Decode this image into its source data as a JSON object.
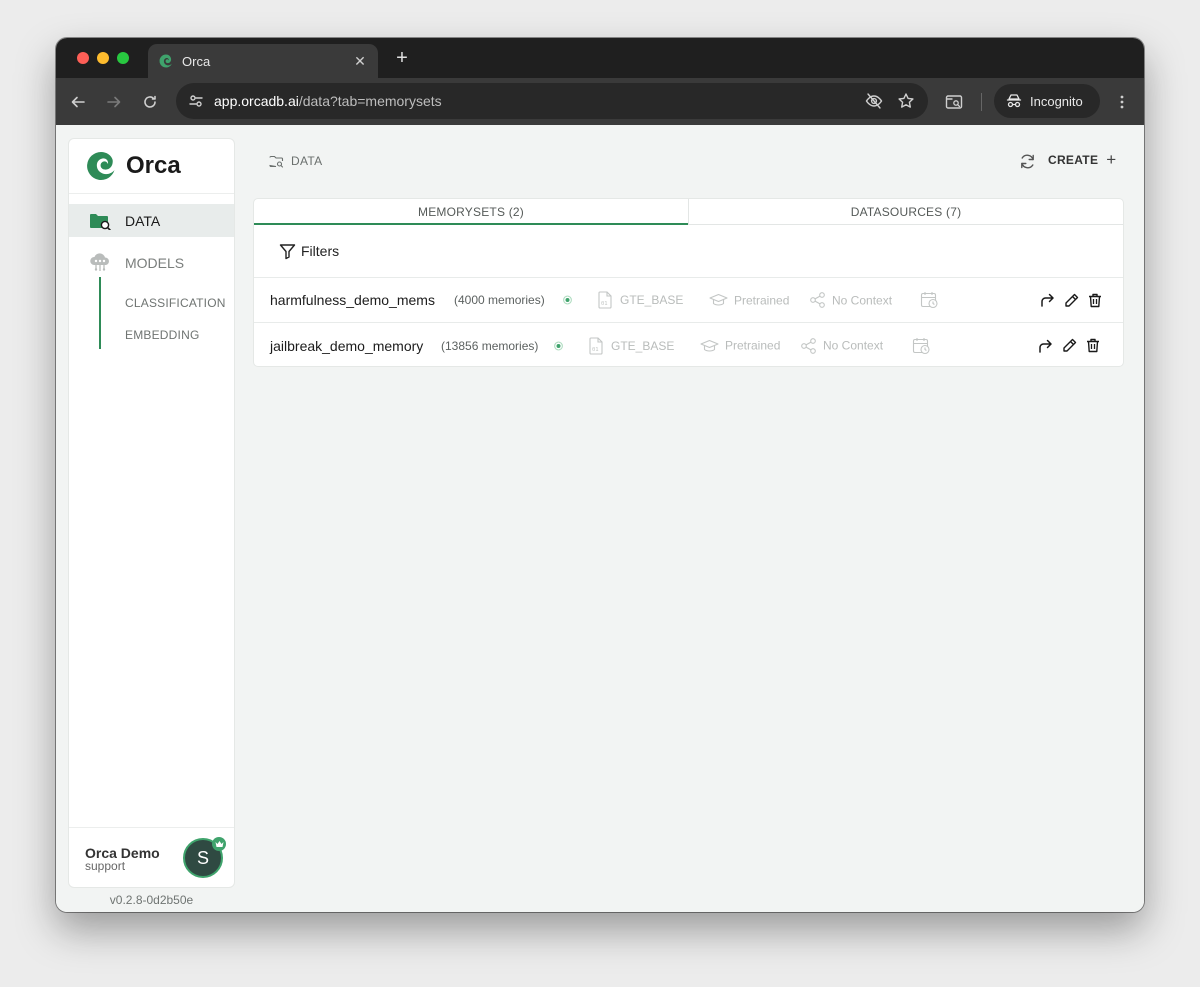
{
  "browser": {
    "tab_title": "Orca",
    "url_host": "app.orcadb.ai",
    "url_path": "/data?tab=memorysets",
    "incognito_label": "Incognito"
  },
  "sidebar": {
    "logo_text": "Orca",
    "nav": {
      "data_label": "DATA",
      "models_label": "MODELS",
      "models_sub": [
        "CLASSIFICATION",
        "EMBEDDING"
      ]
    },
    "user": {
      "name": "Orca Demo",
      "role": "support",
      "avatar_initial": "S"
    },
    "version": "v0.2.8-0d2b50e"
  },
  "header": {
    "breadcrumb": "DATA",
    "create_label": "CREATE",
    "create_glyph": "+"
  },
  "tabs": {
    "memorysets": "MEMORYSETS (2)",
    "datasources": "DATASOURCES (7)"
  },
  "filters_label": "Filters",
  "rows": [
    {
      "name": "harmfulness_demo_mems",
      "count": "(4000 memories)",
      "model": "GTE_BASE",
      "training": "Pretrained",
      "context": "No Context"
    },
    {
      "name": "jailbreak_demo_memory",
      "count": "(13856 memories)",
      "model": "GTE_BASE",
      "training": "Pretrained",
      "context": "No Context"
    }
  ],
  "colors": {
    "accent": "#2e8b57",
    "status_ready": "#3fa36c"
  }
}
